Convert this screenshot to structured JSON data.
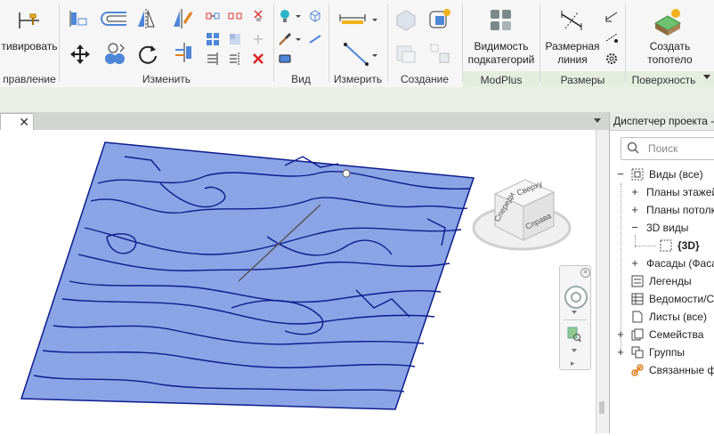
{
  "ribbon": {
    "activate_label": "тивировать",
    "manage_label": "правление",
    "modify_label": "Изменить",
    "view_label": "Вид",
    "measure_label": "Измерить",
    "create_label": "Создание",
    "modplus_label": "ModPlus",
    "dimensions_label": "Размеры",
    "surface_label": "Поверхность",
    "subcat_visibility_label_1": "Видимость",
    "subcat_visibility_label_2": "подкатегорий",
    "dim_line_label_1": "Размерная",
    "dim_line_label_2": "линия",
    "create_topo_label_1": "Создать",
    "create_topo_label_2": "топотело"
  },
  "browser": {
    "title": "Диспетчер проекта -",
    "search_placeholder": "Поиск",
    "items": [
      {
        "label": "Виды (все)"
      },
      {
        "label": "Планы этажей"
      },
      {
        "label": "Планы потолка"
      },
      {
        "label": "3D виды"
      },
      {
        "label": "{3D}"
      },
      {
        "label": "Фасады (Фаса"
      },
      {
        "label": "Легенды"
      },
      {
        "label": "Ведомости/Сп"
      },
      {
        "label": "Листы (все)"
      },
      {
        "label": "Семейства"
      },
      {
        "label": "Группы"
      },
      {
        "label": "Связанные фа"
      }
    ]
  },
  "viewcube": {
    "top_label": "Сверху",
    "front_label": "Спереди",
    "right_label": "Справа"
  },
  "colors": {
    "topo_fill": "#8aa4e6",
    "topo_line": "#0c1c8c",
    "ribbon_green": "#e5eddf"
  }
}
